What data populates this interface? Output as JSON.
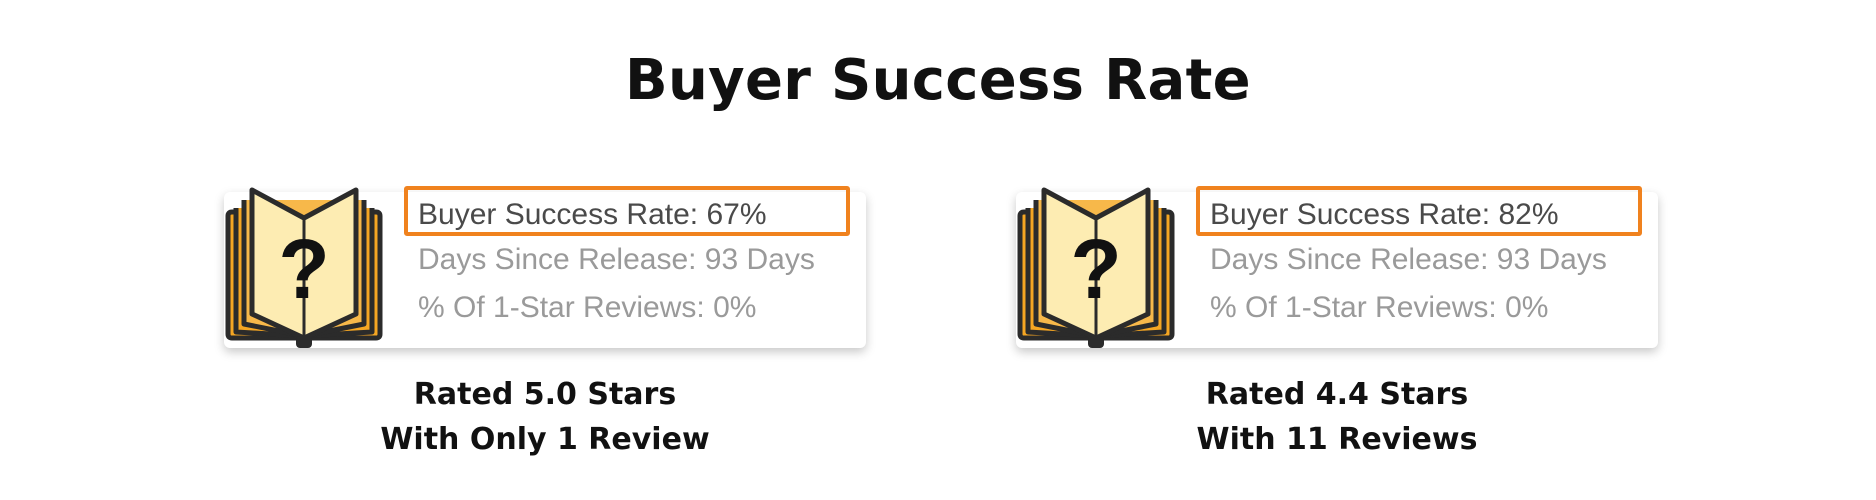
{
  "title": "Buyer Success Rate",
  "colors": {
    "highlight_border": "#f0821e",
    "book_cover": "#f5a623",
    "book_page": "#fdecb2",
    "stat_dim": "#9a9a9a",
    "stat_strong": "#4a4a4a"
  },
  "cards": [
    {
      "icon": "book-question-icon",
      "icon_glyph": "?",
      "stats": {
        "success_rate": "Buyer Success Rate: 67%",
        "days_since_release": "Days Since Release: 93 Days",
        "one_star_pct": "% Of 1-Star Reviews: 0%"
      },
      "caption": {
        "line1": "Rated 5.0 Stars",
        "line2": "With Only 1 Review"
      }
    },
    {
      "icon": "book-question-icon",
      "icon_glyph": "?",
      "stats": {
        "success_rate": "Buyer Success Rate: 82%",
        "days_since_release": "Days Since Release: 93 Days",
        "one_star_pct": "% Of 1-Star Reviews: 0%"
      },
      "caption": {
        "line1": "Rated 4.4 Stars",
        "line2": "With 11 Reviews"
      }
    }
  ]
}
